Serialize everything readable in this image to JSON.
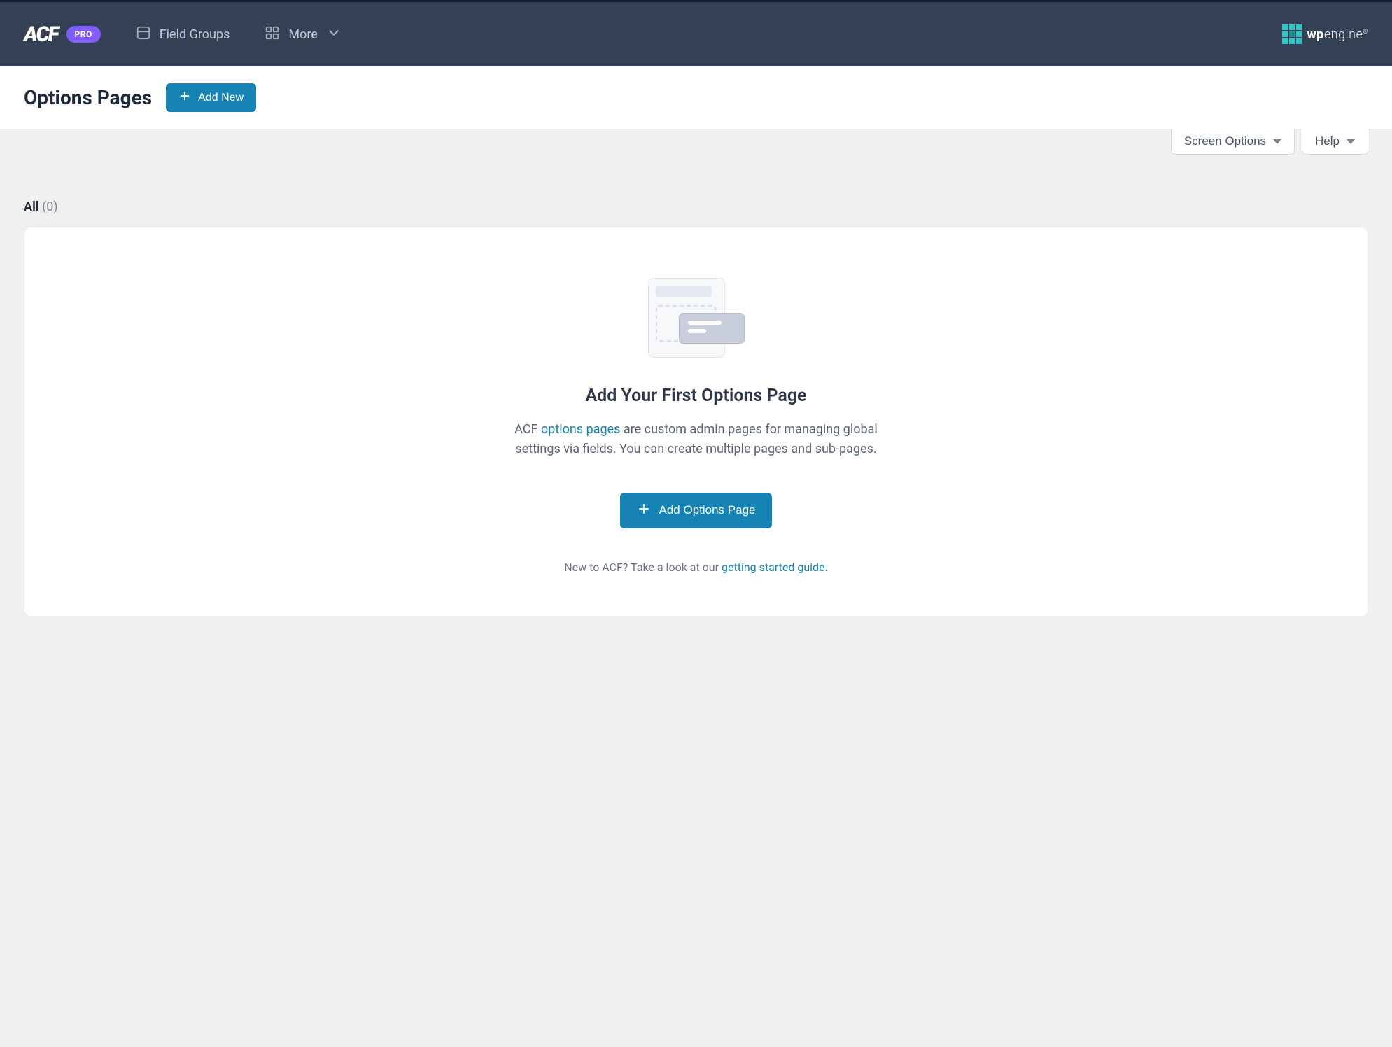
{
  "brand": {
    "logo": "ACF",
    "badge": "PRO"
  },
  "nav": {
    "field_groups": "Field Groups",
    "more": "More"
  },
  "partner": {
    "bold": "wp",
    "light": "engine"
  },
  "titlebar": {
    "title": "Options Pages",
    "add_new": "Add New"
  },
  "meta": {
    "screen_options": "Screen Options",
    "help": "Help"
  },
  "filters": {
    "all_label": "All",
    "all_count": "(0)"
  },
  "empty": {
    "heading": "Add Your First Options Page",
    "desc_pre": "ACF ",
    "desc_link": "options pages",
    "desc_post": " are custom admin pages for managing global settings via fields. You can create multiple pages and sub-pages.",
    "cta": "Add Options Page",
    "footer_pre": "New to ACF? Take a look at our ",
    "footer_link": "getting started guide",
    "footer_post": "."
  }
}
